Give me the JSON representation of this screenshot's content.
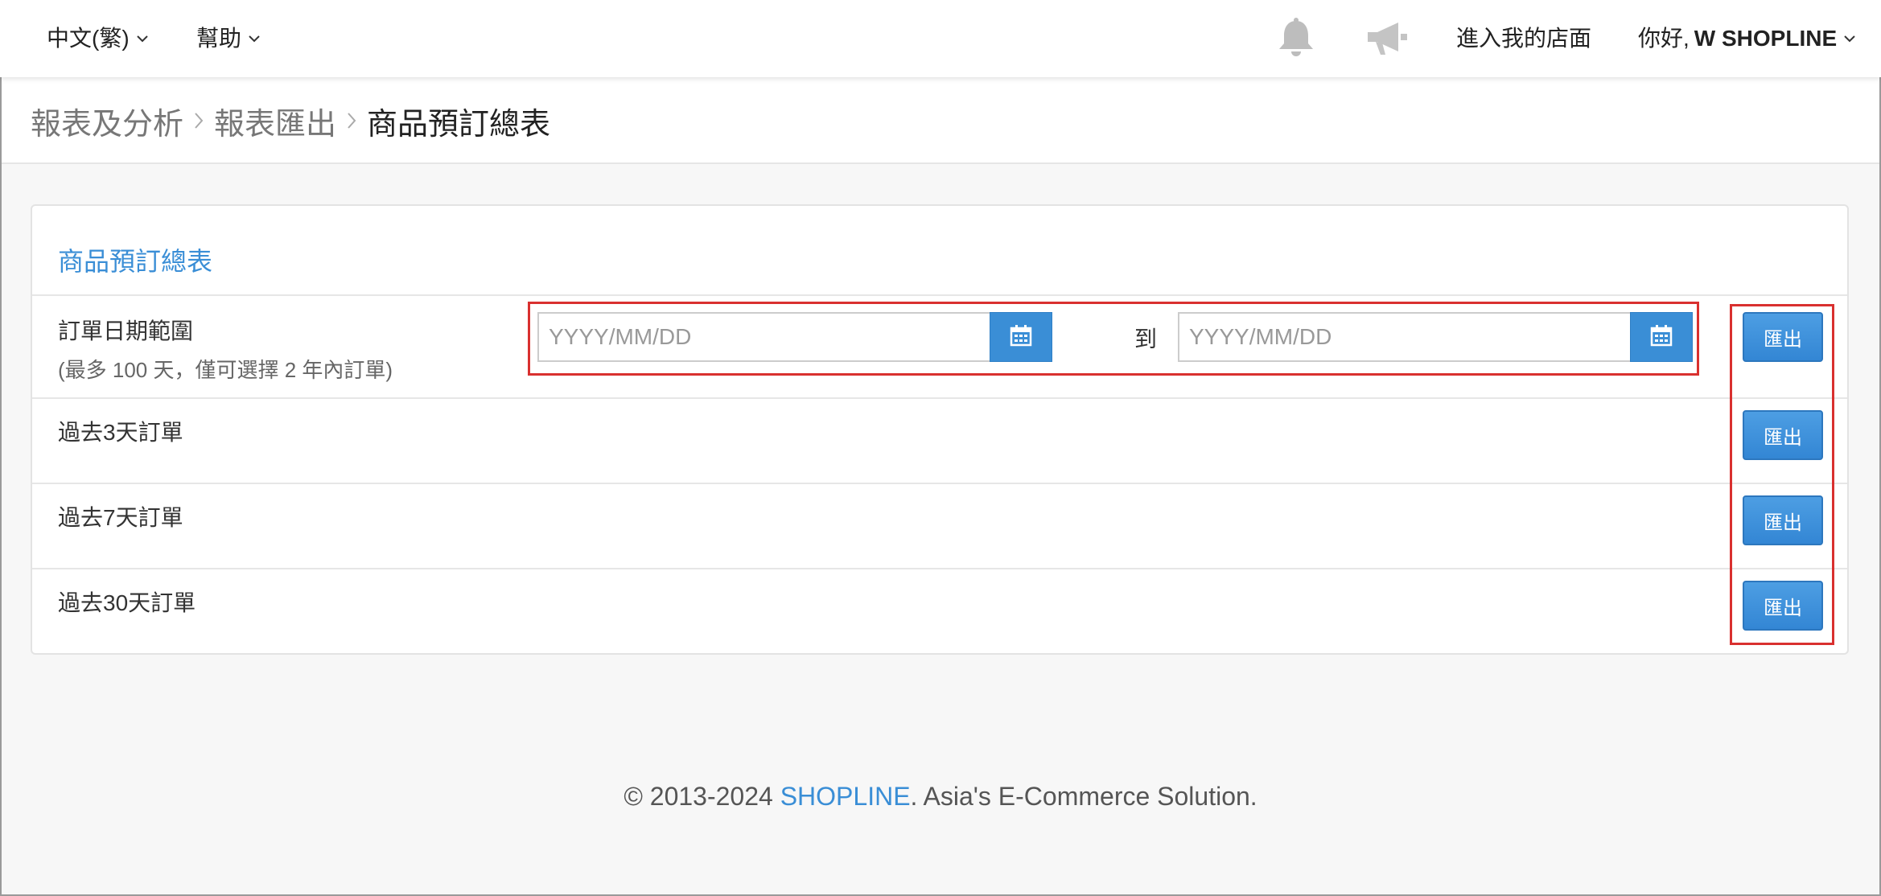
{
  "nav": {
    "language": "中文(繁)",
    "help": "幫助",
    "storefront": "進入我的店面",
    "greeting": "你好,",
    "user": "W SHOPLINE"
  },
  "breadcrumb": {
    "items": [
      "報表及分析",
      "報表匯出",
      "商品預訂總表"
    ]
  },
  "panel": {
    "title": "商品預訂總表",
    "date_range": {
      "label": "訂單日期範圍",
      "hint": "(最多 100 天，僅可選擇 2 年內訂單)",
      "start_placeholder": "YYYY/MM/DD",
      "to": "到",
      "end_placeholder": "YYYY/MM/DD"
    },
    "rows": [
      {
        "label": "過去3天訂單"
      },
      {
        "label": "過去7天訂單"
      },
      {
        "label": "過去30天訂單"
      }
    ],
    "export_label": "匯出"
  },
  "footer": {
    "prefix": "© 2013-2024",
    "brand": "SHOPLINE",
    "suffix": ". Asia's E-Commerce Solution."
  },
  "colors": {
    "accent": "#3a8ed6",
    "highlight": "#d9302f"
  }
}
